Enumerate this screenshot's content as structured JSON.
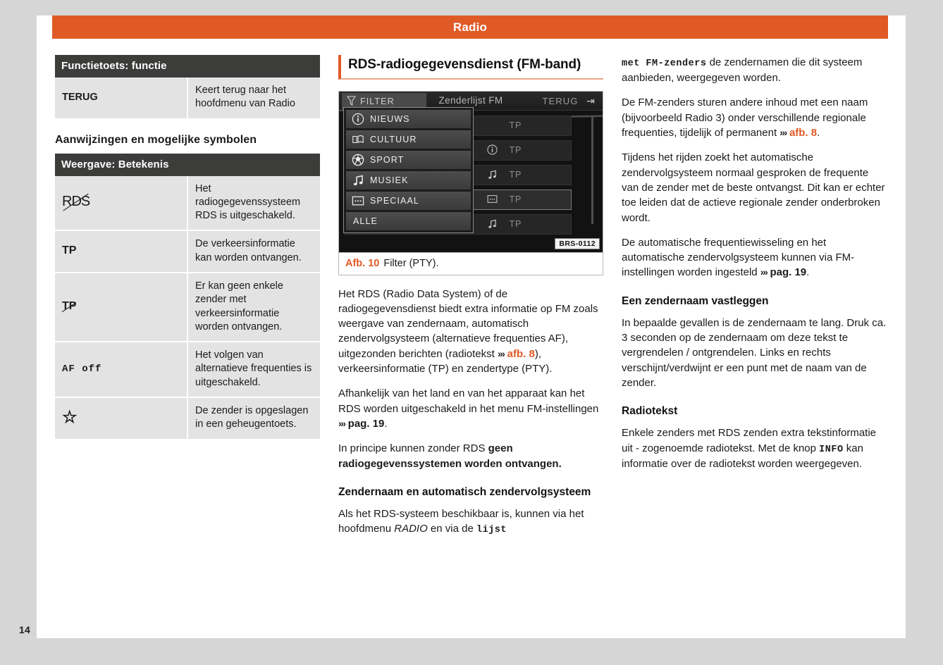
{
  "page": {
    "number": "14",
    "running_head": "Radio",
    "accent_color": "#e05a26",
    "header_bg": "#3c3c3b"
  },
  "left_column": {
    "table_keys": {
      "header": "Functietoets: functie",
      "rows": [
        {
          "key": "TERUG",
          "desc": "Keert terug naar het hoofdmenu van Radio"
        }
      ]
    },
    "subheading": "Aanwijzingen en mogelijke symbolen",
    "table_symbols": {
      "header": "Weergave: Betekenis",
      "rows": [
        {
          "symbol": "RDS",
          "symbol_kind": "rds-struck",
          "desc": "Het radiogegevenssysteem RDS is uitgeschakeld."
        },
        {
          "symbol": "TP",
          "symbol_kind": "text",
          "desc": "De verkeersinformatie kan worden ontvangen."
        },
        {
          "symbol": "TP",
          "symbol_kind": "tp-struck",
          "desc": "Er kan geen enkele zender met verkeersinformatie worden ontvangen."
        },
        {
          "symbol": "AF off",
          "symbol_kind": "mono",
          "desc": "Het volgen van alternatieve frequenties is uitgeschakeld."
        },
        {
          "symbol": "☆",
          "symbol_kind": "star",
          "desc": "De zender is opgeslagen in een geheugentoets."
        }
      ]
    }
  },
  "middle_column": {
    "section_title": "RDS-radiogegevensdienst (FM-band)",
    "figure": {
      "caption_label": "Afb. 10",
      "caption_text": "Filter (PTY).",
      "code": "BRS-0112",
      "screen": {
        "filter_tab": "FILTER",
        "title": "Zenderlijst FM",
        "back_label": "TERUG",
        "menu_items": [
          {
            "label": "NIEUWS",
            "icon": "info-circle-icon"
          },
          {
            "label": "CULTUUR",
            "icon": "book-icon"
          },
          {
            "label": "SPORT",
            "icon": "soccer-ball-icon"
          },
          {
            "label": "MUSIEK",
            "icon": "music-note-icon"
          },
          {
            "label": "SPECIAAL",
            "icon": "dots-box-icon"
          },
          {
            "label": "ALLE",
            "icon": "none"
          }
        ],
        "list_rows": [
          {
            "badge": "TP",
            "icon": "none"
          },
          {
            "badge": "TP",
            "icon": "info-circle-icon"
          },
          {
            "badge": "TP",
            "icon": "music-note-icon"
          },
          {
            "badge": "TP",
            "icon": "dots-box-icon",
            "selected": true
          },
          {
            "badge": "TP",
            "icon": "music-note-icon"
          }
        ]
      }
    },
    "paragraphs": [
      {
        "id": "p1",
        "runs": [
          {
            "t": "Het RDS (Radio Data System) of de radiogegevensdienst biedt extra informatie op FM zoals weergave van zendernaam, automatisch zendervolgsysteem (alternatieve frequenties AF), uitgezonden berichten (radiotekst ",
            "s": "n"
          },
          {
            "t": "›››",
            "s": "chev"
          },
          {
            "t": " ",
            "s": "n"
          },
          {
            "t": "afb. 8",
            "s": "or"
          },
          {
            "t": "), verkeersinformatie (TP) en zendertype (PTY).",
            "s": "n"
          }
        ]
      },
      {
        "id": "p2",
        "runs": [
          {
            "t": "Afhankelijk van het land en van het apparaat kan het RDS worden uitgeschakeld in het menu FM-instellingen ",
            "s": "n"
          },
          {
            "t": "›››",
            "s": "chev"
          },
          {
            "t": " pag. 19",
            "s": "b"
          },
          {
            "t": ".",
            "s": "n"
          }
        ]
      },
      {
        "id": "p3",
        "runs": [
          {
            "t": "In principe kunnen zonder RDS ",
            "s": "n"
          },
          {
            "t": "geen radiogegevenssystemen worden ontvangen.",
            "s": "b"
          }
        ]
      }
    ],
    "heading_2": "Zendernaam en automatisch zendervolgsysteem",
    "paragraph_4": {
      "runs": [
        {
          "t": "Als het RDS-systeem beschikbaar is, kunnen via het hoofdmenu ",
          "s": "n"
        },
        {
          "t": "RADIO",
          "s": "it"
        },
        {
          "t": " en via de ",
          "s": "n"
        },
        {
          "t": "lijst",
          "s": "mono"
        }
      ]
    }
  },
  "right_column": {
    "paragraphs": [
      {
        "id": "r1",
        "runs": [
          {
            "t": "met FM-zenders",
            "s": "mono"
          },
          {
            "t": " de zendernamen die dit systeem aanbieden, weergegeven worden.",
            "s": "n"
          }
        ]
      },
      {
        "id": "r2",
        "runs": [
          {
            "t": "De FM-zenders sturen andere inhoud met een naam (bijvoorbeeld Radio 3) onder verschillende regionale frequenties, tijdelijk of permanent ",
            "s": "n"
          },
          {
            "t": "›››",
            "s": "chev"
          },
          {
            "t": " ",
            "s": "n"
          },
          {
            "t": "afb. 8",
            "s": "or"
          },
          {
            "t": ".",
            "s": "n"
          }
        ]
      },
      {
        "id": "r3",
        "runs": [
          {
            "t": "Tijdens het rijden zoekt het automatische zendervolgsysteem normaal gesproken de frequente van de zender met de beste ontvangst. Dit kan er echter toe leiden dat de actieve regionale zender onderbroken wordt.",
            "s": "n"
          }
        ]
      },
      {
        "id": "r4",
        "runs": [
          {
            "t": "De automatische frequentiewisseling en het automatische zendervolgsysteem kunnen via FM-instellingen worden ingesteld ",
            "s": "n"
          },
          {
            "t": "›››",
            "s": "chev"
          },
          {
            "t": " pag. 19",
            "s": "b"
          },
          {
            "t": ".",
            "s": "n"
          }
        ]
      }
    ],
    "heading_1": "Een zendernaam vastleggen",
    "paragraph_5": {
      "runs": [
        {
          "t": "In bepaalde gevallen is de zendernaam te lang. Druk ca. 3 seconden op de zendernaam om deze tekst te vergrendelen / ontgrendelen. Links en rechts verschijnt/verdwijnt er een punt met de naam van de zender.",
          "s": "n"
        }
      ]
    },
    "heading_2": "Radiotekst",
    "paragraph_6": {
      "runs": [
        {
          "t": "Enkele zenders met RDS zenden extra tekstinformatie uit - zogenoemde radiotekst. Met de knop ",
          "s": "n"
        },
        {
          "t": "INFO",
          "s": "mono"
        },
        {
          "t": " kan informatie over de radiotekst worden weergegeven.",
          "s": "n"
        }
      ]
    }
  }
}
